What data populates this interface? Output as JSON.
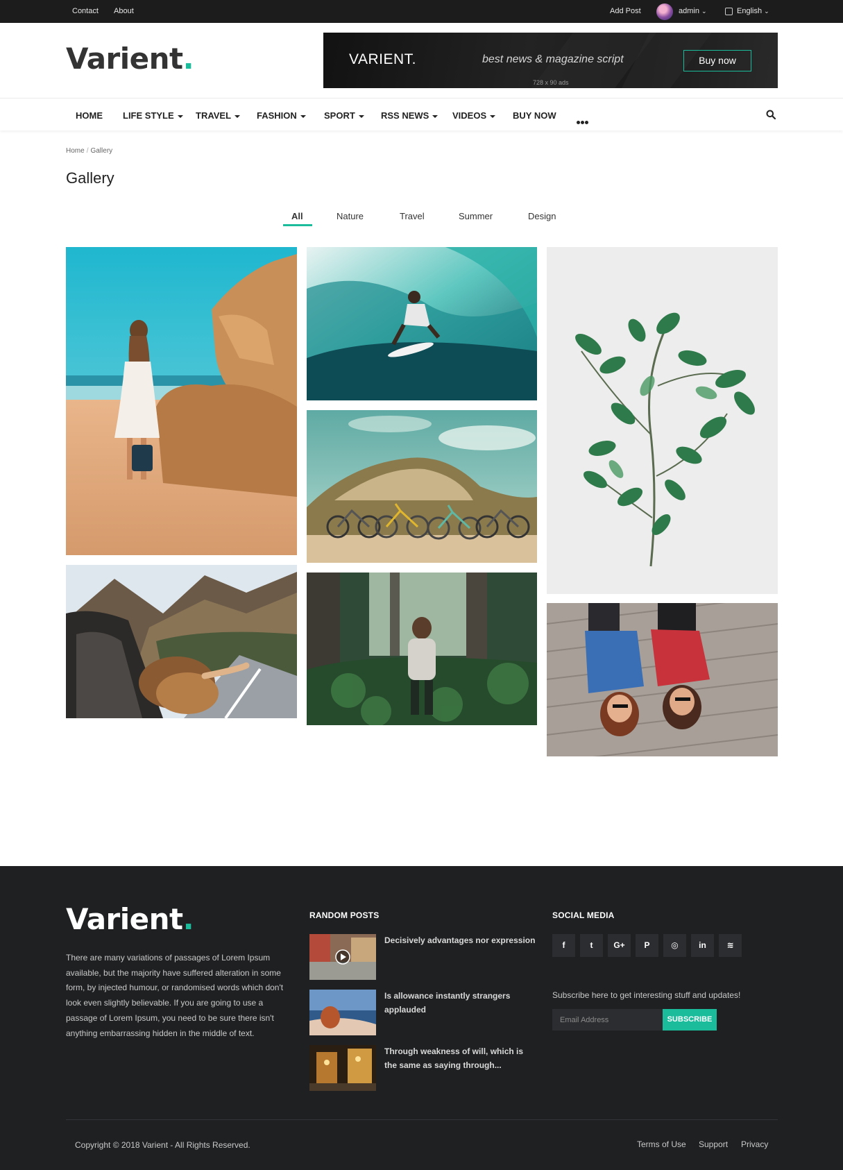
{
  "topbar": {
    "links": [
      "Contact",
      "About"
    ],
    "add_post": "Add Post",
    "user": "admin",
    "language": "English"
  },
  "header": {
    "logo_text": "Varient",
    "logo_dot": ".",
    "banner": {
      "brand": "VARIENT.",
      "tagline": "best news & magazine script",
      "size_note": "728 x 90 ads",
      "button": "Buy now"
    }
  },
  "nav": {
    "items": [
      {
        "label": "HOME",
        "dropdown": false
      },
      {
        "label": "LIFE STYLE",
        "dropdown": true
      },
      {
        "label": "TRAVEL",
        "dropdown": true
      },
      {
        "label": "FASHION",
        "dropdown": true
      },
      {
        "label": "SPORT",
        "dropdown": true
      },
      {
        "label": "RSS NEWS",
        "dropdown": true
      },
      {
        "label": "VIDEOS",
        "dropdown": true
      },
      {
        "label": "BUY NOW",
        "dropdown": false
      }
    ],
    "icons": [
      "more-dots-icon",
      "search-icon"
    ]
  },
  "breadcrumb": {
    "home": "Home",
    "separator": "/",
    "current": "Gallery"
  },
  "page": {
    "title": "Gallery",
    "filters": [
      "All",
      "Nature",
      "Travel",
      "Summer",
      "Design"
    ],
    "active_filter": "All"
  },
  "gallery": {
    "images": [
      "beach-woman",
      "surfer-wave",
      "plant-leaves",
      "bicycles-dune",
      "car-window-hair",
      "forest-backpacker",
      "couple-lying-deck"
    ]
  },
  "footer": {
    "logo_text": "Varient",
    "logo_dot": ".",
    "about": "There are many variations of passages of Lorem Ipsum available, but the majority have suffered alteration in some form, by injected humour, or randomised words which don't look even slightly believable. If you are going to use a passage of Lorem Ipsum, you need to be sure there isn't anything embarrassing hidden in the middle of text.",
    "random_posts_heading": "RANDOM POSTS",
    "random_posts": [
      "Decisively advantages nor expression",
      "Is allowance instantly strangers applauded",
      "Through weakness of will, which is the same as saying through..."
    ],
    "social_heading": "SOCIAL MEDIA",
    "social": [
      {
        "name": "facebook",
        "glyph": "f"
      },
      {
        "name": "twitter",
        "glyph": "t"
      },
      {
        "name": "google-plus",
        "glyph": "G+"
      },
      {
        "name": "pinterest",
        "glyph": "P"
      },
      {
        "name": "instagram",
        "glyph": "◎"
      },
      {
        "name": "linkedin",
        "glyph": "in"
      },
      {
        "name": "rss",
        "glyph": "≋"
      }
    ],
    "subscribe_text": "Subscribe here to get interesting stuff and updates!",
    "email_placeholder": "Email Address",
    "subscribe_button": "SUBSCRIBE",
    "copyright": "Copyright © 2018 Varient - All Rights Reserved.",
    "links": [
      "Terms of Use",
      "Support",
      "Privacy"
    ]
  },
  "colors": {
    "accent": "#1abc9c",
    "dark": "#1c1c1c",
    "footer_bg": "#1f2022"
  }
}
